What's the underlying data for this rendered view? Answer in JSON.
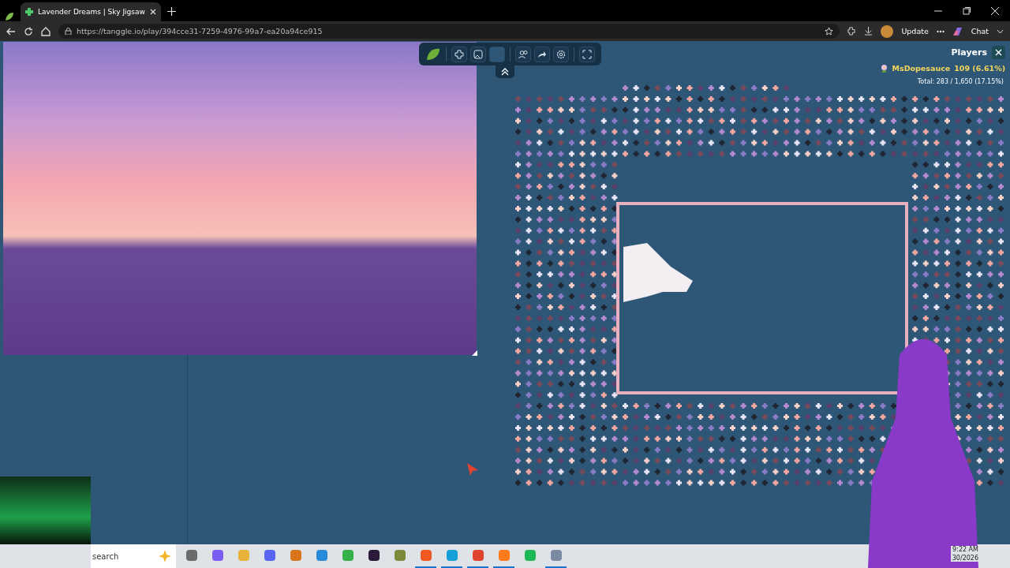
{
  "browser": {
    "tab": {
      "title": "Lavender Dreams | Sky Jigsaw",
      "selected": true
    },
    "url": "https://tanggle.io/play/394cce31-7259-4976-99a7-ea20a94ce915",
    "update_label": "Update",
    "chat_label": "Chat"
  },
  "players_panel": {
    "title": "Players",
    "players": [
      {
        "name": "MsDopesauce",
        "score": "109 (6.61%)"
      }
    ],
    "total": "Total: 283 / 1,650 (17.15%)"
  },
  "taskbar": {
    "search_placeholder": "search",
    "apps": [
      {
        "open": false
      },
      {
        "open": false
      },
      {
        "open": false
      },
      {
        "open": false
      },
      {
        "open": false
      },
      {
        "open": false
      },
      {
        "open": false
      },
      {
        "open": false
      },
      {
        "open": false
      },
      {
        "open": true
      },
      {
        "open": true
      },
      {
        "open": true
      },
      {
        "open": true
      },
      {
        "open": false
      },
      {
        "open": true
      }
    ],
    "time": "9:22 AM",
    "date": "30/2026"
  }
}
